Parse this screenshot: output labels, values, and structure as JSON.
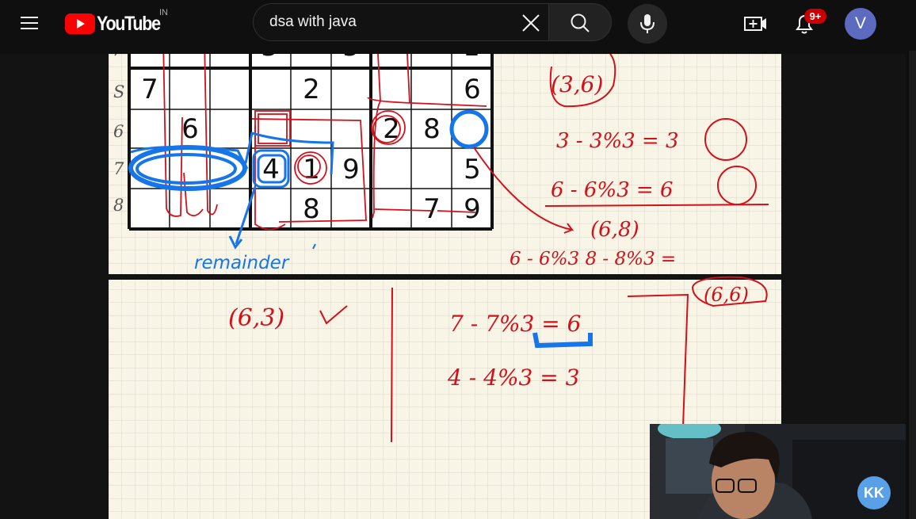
{
  "header": {
    "menu_icon": "hamburger-menu-icon",
    "logo_text": "YouTube",
    "region": "IN",
    "search_value": "dsa with java",
    "notifications_badge": "9+",
    "avatar_initial": "V"
  },
  "icons": {
    "clear": "close-icon",
    "search": "search-icon",
    "mic": "microphone-icon",
    "create": "video-plus-icon",
    "notifications": "bell-icon"
  },
  "colors": {
    "brand_red": "#ff0000",
    "badge_red": "#cc0000",
    "avatar": "#5c6bc0",
    "ink_red": "#d4101a",
    "ink_blue": "#1675e8"
  },
  "video": {
    "sudoku": {
      "rows": [
        [
          "7",
          "",
          "",
          "",
          "2",
          "",
          "",
          "",
          "6"
        ],
        [
          "",
          "6",
          "",
          "",
          "",
          "",
          "2",
          "8",
          ""
        ],
        [
          "",
          "",
          "",
          "4",
          "1",
          "9",
          "",
          "",
          "5"
        ],
        [
          "",
          "",
          "",
          "",
          "8",
          "",
          "",
          "7",
          "9"
        ]
      ],
      "row_labels": [
        "S",
        "6",
        "7",
        "8"
      ]
    },
    "notes": {
      "remainder": "remainder",
      "pair_top": "(3,6)",
      "eq1": "3 - 3%3 = 3",
      "eq2": "6 - 6%3 = 6",
      "pair_68": "(6,8)",
      "eq3": "6 - 6%3   8 - 8%3 =",
      "pair_63": "(6,3)",
      "eq4": "7 - 7%3 = 6",
      "eq5": "4 - 4%3 = 3",
      "pair_66": "(6,6)"
    },
    "channel_watermark": "KK"
  }
}
